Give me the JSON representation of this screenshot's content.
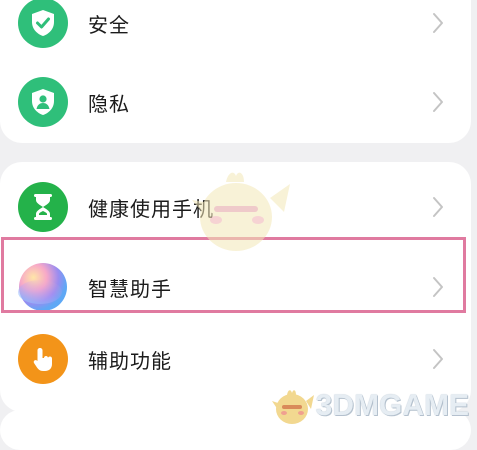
{
  "settings": {
    "items": [
      {
        "label": "安全",
        "icon": "shield-check-icon",
        "color": "#2fbf7a"
      },
      {
        "label": "隐私",
        "icon": "privacy-shield-icon",
        "color": "#2fbf7a"
      },
      {
        "label": "健康使用手机",
        "icon": "hourglass-icon",
        "color": "#24b24a"
      },
      {
        "label": "智慧助手",
        "icon": "smart-assistant-orb-icon",
        "color": "#b58ae6"
      },
      {
        "label": "辅助功能",
        "icon": "hand-tap-icon",
        "color": "#f39419"
      }
    ],
    "highlight_color": "#e07aa0"
  },
  "watermark": {
    "text": "3DMGAME"
  }
}
